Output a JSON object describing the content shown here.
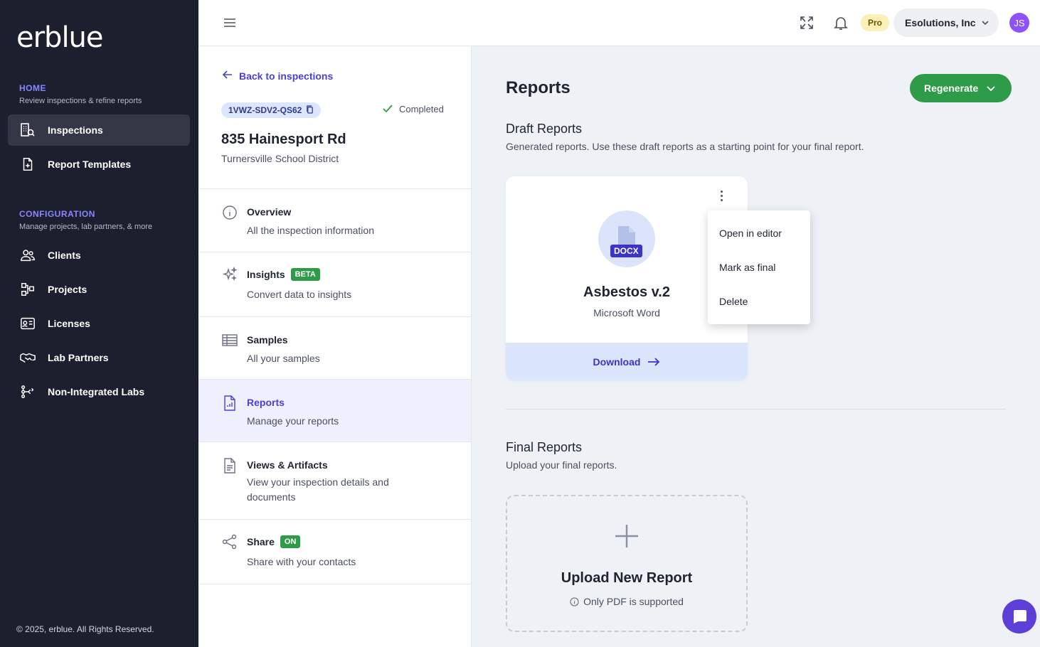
{
  "app": {
    "logo": "erblue"
  },
  "sidebar": {
    "home": {
      "title": "HOME",
      "subtitle": "Review inspections & refine reports"
    },
    "home_items": [
      {
        "label": "Inspections",
        "icon": "inspections-icon",
        "active": true
      },
      {
        "label": "Report Templates",
        "icon": "report-template-icon"
      }
    ],
    "config": {
      "title": "CONFIGURATION",
      "subtitle": "Manage projects, lab partners, & more"
    },
    "config_items": [
      {
        "label": "Clients",
        "icon": "clients-icon"
      },
      {
        "label": "Projects",
        "icon": "projects-icon"
      },
      {
        "label": "Licenses",
        "icon": "licenses-icon"
      },
      {
        "label": "Lab Partners",
        "icon": "handshake-icon"
      },
      {
        "label": "Non-Integrated Labs",
        "icon": "labs-icon"
      }
    ],
    "footer": "© 2025, erblue. All Rights Reserved."
  },
  "topbar": {
    "plan_badge": "Pro",
    "organization": "Esolutions, Inc",
    "avatar_initials": "JS"
  },
  "inspection": {
    "back_label": "Back to inspections",
    "id": "1VWZ-SDV2-QS62",
    "status": "Completed",
    "address": "835 Hainesport Rd",
    "district": "Turnersville School District"
  },
  "menu": [
    {
      "title": "Overview",
      "desc": "All the inspection information",
      "icon": "info-icon"
    },
    {
      "title": "Insights",
      "tag": "BETA",
      "desc": "Convert data to insights",
      "icon": "sparkles-icon"
    },
    {
      "title": "Samples",
      "desc": "All your samples",
      "icon": "table-icon"
    },
    {
      "title": "Reports",
      "desc": "Manage your reports",
      "icon": "report-icon",
      "active": true
    },
    {
      "title": "Views & Artifacts",
      "desc": "View your inspection details and documents",
      "icon": "document-icon"
    },
    {
      "title": "Share",
      "tag": "ON",
      "desc": "Share with your contacts",
      "icon": "share-icon"
    }
  ],
  "main": {
    "title": "Reports",
    "regenerate_label": "Regenerate",
    "draft": {
      "heading": "Draft Reports",
      "desc": "Generated reports. Use these draft reports as a starting point for your final report.",
      "card": {
        "badge": "DOCX",
        "title": "Asbestos v.2",
        "subtitle": "Microsoft Word",
        "download_label": "Download"
      },
      "dropdown": [
        "Open in editor",
        "Mark as final",
        "Delete"
      ]
    },
    "final": {
      "heading": "Final Reports",
      "desc": "Upload your final reports.",
      "upload_title": "Upload New Report",
      "upload_hint": "Only PDF is supported"
    }
  },
  "colors": {
    "sidebar_bg": "#1c1f2e",
    "accent": "#4a3fd6",
    "success": "#2e9b48",
    "section_title": "#8b85ff"
  }
}
